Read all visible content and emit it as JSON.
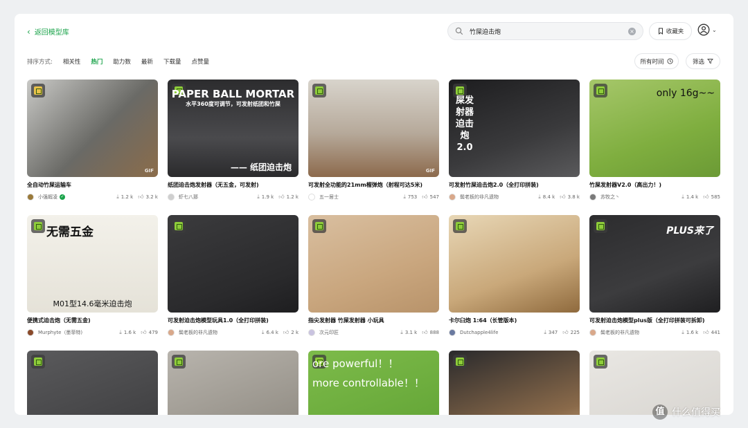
{
  "header": {
    "back_label": "返回模型库",
    "search_value": "竹屎迫击炮",
    "favorites_label": "收藏夹"
  },
  "sort": {
    "label": "排序方式:",
    "options": [
      "相关性",
      "热门",
      "助力数",
      "最新",
      "下载量",
      "点赞量"
    ],
    "active": "热门",
    "time_label": "所有时间",
    "filter_label": "筛选"
  },
  "colors": {
    "accent": "#1aa34a",
    "badge": "#8ecc3a"
  },
  "items": [
    {
      "title": "全自动竹屎运输车",
      "author": "小强嘏凌",
      "verified": true,
      "downloads": "1.2 k",
      "likes": "3.2 k",
      "gif": "GIF",
      "caption": "",
      "bg": "linear-gradient(135deg,#c9c9c6,#6a6a66 55%,#8b6c4a)"
    },
    {
      "title": "纸团迫击炮发射器（无五金，可发射)",
      "author": "虾七八那",
      "verified": false,
      "downloads": "1.9 k",
      "likes": "1.2 k",
      "gif": "",
      "caption": "PAPER BALL MORTAR",
      "caption2": "水平360度可调节，可发射纸团和竹屎",
      "caption3": "—— 纸团迫击炮",
      "bg": "linear-gradient(180deg,#2c2c2e,#4a4a4d 60%,#2a2a2c)"
    },
    {
      "title": "可发射全功能的21mm榴弹炮（射程可达5米)",
      "author": "五一居士",
      "verified": false,
      "downloads": "753",
      "likes": "547",
      "gif": "GIF",
      "caption": "",
      "bg": "linear-gradient(180deg,#d8d4cc,#b6a99a 55%,#8c6a4c)"
    },
    {
      "title": "可发射竹屎迫击炮2.0（全打印拼装)",
      "author": "鬓老板的非凡遗物",
      "verified": false,
      "downloads": "8.4 k",
      "likes": "3.8 k",
      "gif": "",
      "caption": "屎发射器 迫击炮2.0",
      "bg": "linear-gradient(160deg,#1d1d1f,#3a3a3c 60%,#5a5a5c)"
    },
    {
      "title": "竹屎发射器V2.0（高出力！)",
      "author": "苏牧之丶",
      "verified": false,
      "downloads": "1.4 k",
      "likes": "585",
      "gif": "",
      "caption": "only 16g~~",
      "bg": "linear-gradient(160deg,#a6c76a,#7fae3f 60%,#6b9a35)"
    },
    {
      "title": "便携式迫击炮（无需五金)",
      "author": "Murphyte（墨菲特)",
      "verified": false,
      "downloads": "1.6 k",
      "likes": "479",
      "gif": "",
      "caption": "无需五金",
      "caption2": "M01型14.6毫米迫击炮",
      "bg": "linear-gradient(180deg,#f3f1ea,#e5e2d8)"
    },
    {
      "title": "可发射迫击炮模型玩具1.0（全打印拼装)",
      "author": "鬓老板的非凡遗物",
      "verified": false,
      "downloads": "6.4 k",
      "likes": "2 k",
      "gif": "",
      "caption": "",
      "bg": "linear-gradient(160deg,#3b3b3d,#2a2a2c 70%,#1e1e20)"
    },
    {
      "title": "指尖发射器 竹屎发射器 小玩具",
      "author": "次元印匠",
      "verified": false,
      "downloads": "3.1 k",
      "likes": "888",
      "gif": "",
      "caption": "",
      "bg": "linear-gradient(160deg,#d9bfa0,#c9a67e 60%,#b8936a)"
    },
    {
      "title": "卡尔臼炮 1:64（长管版本)",
      "author": "Dutchapple4life",
      "verified": false,
      "downloads": "347",
      "likes": "225",
      "gif": "",
      "caption": "",
      "bg": "linear-gradient(160deg,#e8d7b6,#c9a87a 60%,#8f6a3d)"
    },
    {
      "title": "可发射迫击炮模型plus版（全打印拼装可拆卸)",
      "author": "鬓老板的非凡遗物",
      "verified": false,
      "downloads": "1.6 k",
      "likes": "441",
      "gif": "",
      "caption": "PLUS来了",
      "bg": "linear-gradient(160deg,#2c2c2e,#3c3c3e 60%,#1f1f21)"
    },
    {
      "title": "",
      "author": "",
      "downloads": "",
      "likes": "",
      "gif": "",
      "caption": "",
      "bg": "linear-gradient(160deg,#5a5a5c,#3a3a3c)"
    },
    {
      "title": "",
      "author": "",
      "downloads": "",
      "likes": "",
      "gif": "",
      "caption": "",
      "bg": "linear-gradient(160deg,#b8b4ad,#8a857c)"
    },
    {
      "title": "",
      "author": "",
      "downloads": "",
      "likes": "",
      "gif": "",
      "caption": "ore powerful！！",
      "caption2": "more controllable！！",
      "bg": "linear-gradient(160deg,#7dbb4a,#5fa133)"
    },
    {
      "title": "",
      "author": "",
      "downloads": "",
      "likes": "",
      "gif": "",
      "caption": "",
      "bg": "linear-gradient(160deg,#2a2a2c,#8a6a4a 70%,#c9a67e)"
    },
    {
      "title": "",
      "author": "",
      "downloads": "",
      "likes": "",
      "gif": "",
      "caption": "",
      "bg": "linear-gradient(160deg,#e9e7e3,#d4d1cc)"
    }
  ],
  "watermark": "什么值得买"
}
